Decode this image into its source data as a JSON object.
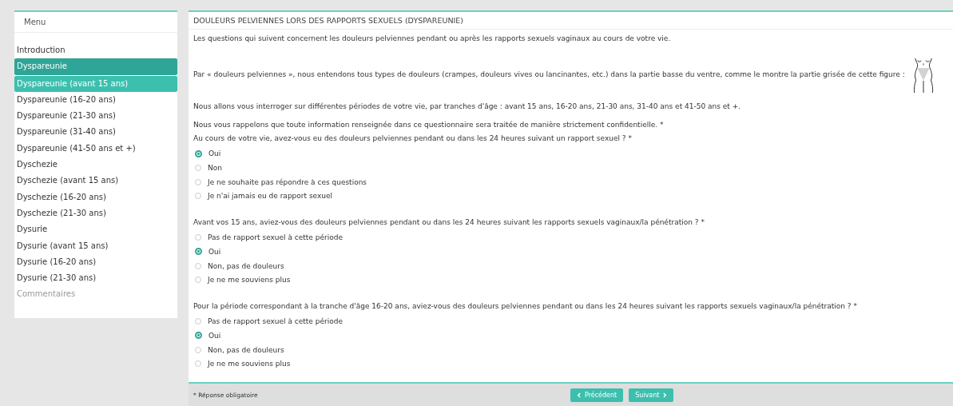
{
  "sidebar": {
    "title": "Menu",
    "items": [
      {
        "label": "Introduction",
        "selected": false,
        "disabled": false
      },
      {
        "label": "Dyspareunie",
        "selected": true,
        "disabled": false
      },
      {
        "label": "Dyspareunie (avant 15 ans)",
        "selected": true,
        "disabled": false
      },
      {
        "label": "Dyspareunie (16-20 ans)",
        "selected": false,
        "disabled": false
      },
      {
        "label": "Dyspareunie (21-30 ans)",
        "selected": false,
        "disabled": false
      },
      {
        "label": "Dyspareunie (31-40 ans)",
        "selected": false,
        "disabled": false
      },
      {
        "label": "Dyspareunie (41-50 ans et +)",
        "selected": false,
        "disabled": false
      },
      {
        "label": "Dyschezie",
        "selected": false,
        "disabled": false
      },
      {
        "label": "Dyschezie (avant 15 ans)",
        "selected": false,
        "disabled": false
      },
      {
        "label": "Dyschezie (16-20 ans)",
        "selected": false,
        "disabled": false
      },
      {
        "label": "Dyschezie (21-30 ans)",
        "selected": false,
        "disabled": false
      },
      {
        "label": "Dysurie",
        "selected": false,
        "disabled": false
      },
      {
        "label": "Dysurie (avant 15 ans)",
        "selected": false,
        "disabled": false
      },
      {
        "label": "Dysurie (16-20 ans)",
        "selected": false,
        "disabled": false
      },
      {
        "label": "Dysurie (21-30 ans)",
        "selected": false,
        "disabled": false
      },
      {
        "label": "Commentaires",
        "selected": false,
        "disabled": true
      }
    ]
  },
  "main": {
    "title": "DOULEURS PELVIENNES LORS DES RAPPORTS SEXUELS (DYSPAREUNIE)",
    "intro": "Les questions qui suivent concernent les douleurs pelviennes pendant ou après les rapports sexuels vaginaux au cours de votre vie.",
    "definition": "Par « douleurs pelviennes », nous entendons tous types de douleurs (crampes, douleurs vives ou lancinantes, etc.) dans la partie basse du ventre, comme le montre la partie grisée de cette figure :",
    "periods": "Nous allons vous interroger sur différentes périodes de votre vie, par tranches d'âge : avant 15 ans, 16-20 ans, 21-30 ans, 31-40 ans et 41-50 ans et +.",
    "confidential": "Nous vous rappelons que toute information renseignée dans ce questionnaire sera traitée de manière strictement confidentielle. *",
    "questions": [
      {
        "text": "Au cours de votre vie, avez-vous eu des douleurs pelviennes pendant ou dans les 24 heures suivant un rapport sexuel ? *",
        "options": [
          {
            "label": "Oui",
            "selected": true
          },
          {
            "label": "Non",
            "selected": false
          },
          {
            "label": "Je ne souhaite pas répondre à ces questions",
            "selected": false
          },
          {
            "label": "Je n'ai jamais eu de rapport sexuel",
            "selected": false
          }
        ]
      },
      {
        "text": "Avant vos 15 ans, aviez-vous des douleurs pelviennes pendant ou dans les 24 heures suivant les rapports sexuels vaginaux/la pénétration ? *",
        "options": [
          {
            "label": "Pas de rapport sexuel à cette période",
            "selected": false
          },
          {
            "label": "Oui",
            "selected": true
          },
          {
            "label": "Non, pas de douleurs",
            "selected": false
          },
          {
            "label": "Je ne me souviens plus",
            "selected": false
          }
        ]
      },
      {
        "text": "Pour la période correspondant à la tranche d'âge 16-20 ans, aviez-vous des douleurs pelviennes pendant ou dans les 24 heures suivant les rapports sexuels vaginaux/la pénétration ? *",
        "options": [
          {
            "label": "Pas de rapport sexuel à cette période",
            "selected": false
          },
          {
            "label": "Oui",
            "selected": true
          },
          {
            "label": "Non, pas de douleurs",
            "selected": false
          },
          {
            "label": "Je ne me souviens plus",
            "selected": false
          }
        ]
      }
    ]
  },
  "footer": {
    "note": "* Réponse obligatoire",
    "prev": "Précédent",
    "next": "Suivant"
  }
}
